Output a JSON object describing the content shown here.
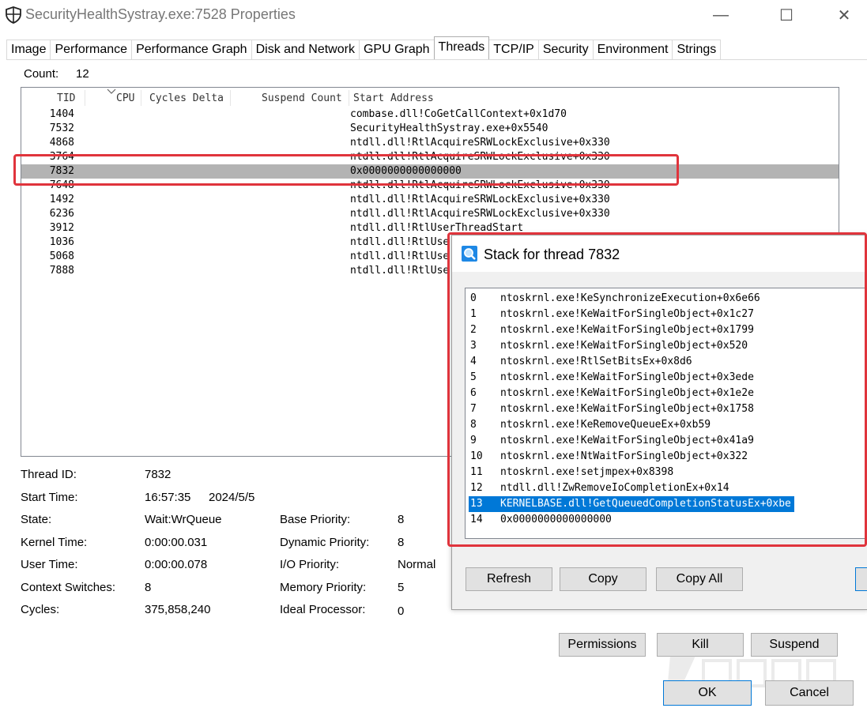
{
  "window": {
    "title": "SecurityHealthSystray.exe:7528 Properties",
    "minimize_glyph": "—",
    "maximize_glyph": "☐",
    "close_glyph": "✕"
  },
  "tabs": [
    {
      "label": "Image"
    },
    {
      "label": "Performance"
    },
    {
      "label": "Performance Graph"
    },
    {
      "label": "Disk and Network"
    },
    {
      "label": "GPU Graph"
    },
    {
      "label": "Threads",
      "active": true
    },
    {
      "label": "TCP/IP"
    },
    {
      "label": "Security"
    },
    {
      "label": "Environment"
    },
    {
      "label": "Strings"
    }
  ],
  "threads": {
    "count_label": "Count:",
    "count_value": "12",
    "columns": {
      "tid": "TID",
      "cpu": "CPU",
      "cycles": "Cycles Delta",
      "suspend": "Suspend Count",
      "start": "Start Address"
    },
    "rows": [
      {
        "tid": "1404",
        "addr": "combase.dll!CoGetCallContext+0x1d70"
      },
      {
        "tid": "7532",
        "addr": "SecurityHealthSystray.exe+0x5540"
      },
      {
        "tid": "4868",
        "addr": "ntdll.dll!RtlAcquireSRWLockExclusive+0x330"
      },
      {
        "tid": "3764",
        "addr": "ntdll.dll!RtlAcquireSRWLockExclusive+0x330"
      },
      {
        "tid": "7832",
        "addr": "0x0000000000000000",
        "selected": true
      },
      {
        "tid": "7648",
        "addr": "ntdll.dll!RtlAcquireSRWLockExclusive+0x330"
      },
      {
        "tid": "1492",
        "addr": "ntdll.dll!RtlAcquireSRWLockExclusive+0x330"
      },
      {
        "tid": "6236",
        "addr": "ntdll.dll!RtlAcquireSRWLockExclusive+0x330"
      },
      {
        "tid": "3912",
        "addr": "ntdll.dll!RtlUserThreadStart"
      },
      {
        "tid": "1036",
        "addr": "ntdll.dll!RtlUse"
      },
      {
        "tid": "5068",
        "addr": "ntdll.dll!RtlUse"
      },
      {
        "tid": "7888",
        "addr": "ntdll.dll!RtlUse"
      }
    ]
  },
  "details": {
    "thread_id_label": "Thread ID:",
    "thread_id": "7832",
    "start_time_label": "Start Time:",
    "start_time": "16:57:35",
    "start_date": "2024/5/5",
    "state_label": "State:",
    "state": "Wait:WrQueue",
    "kernel_time_label": "Kernel Time:",
    "kernel_time": "0:00:00.031",
    "user_time_label": "User Time:",
    "user_time": "0:00:00.078",
    "context_switches_label": "Context Switches:",
    "context_switches": "8",
    "cycles_label": "Cycles:",
    "cycles": "375,858,240",
    "base_priority_label": "Base Priority:",
    "base_priority": "8",
    "dynamic_priority_label": "Dynamic Priority:",
    "dynamic_priority": "8",
    "io_priority_label": "I/O Priority:",
    "io_priority": "Normal",
    "memory_priority_label": "Memory Priority:",
    "memory_priority": "5",
    "ideal_processor_label": "Ideal Processor:",
    "ideal_processor": "0"
  },
  "buttons": {
    "permissions": "Permissions",
    "kill": "Kill",
    "suspend": "Suspend",
    "ok": "OK",
    "cancel": "Cancel"
  },
  "stack_dialog": {
    "title": "Stack for thread 7832",
    "frames": [
      {
        "n": "0",
        "fn": "ntoskrnl.exe!KeSynchronizeExecution+0x6e66"
      },
      {
        "n": "1",
        "fn": "ntoskrnl.exe!KeWaitForSingleObject+0x1c27"
      },
      {
        "n": "2",
        "fn": "ntoskrnl.exe!KeWaitForSingleObject+0x1799"
      },
      {
        "n": "3",
        "fn": "ntoskrnl.exe!KeWaitForSingleObject+0x520"
      },
      {
        "n": "4",
        "fn": "ntoskrnl.exe!RtlSetBitsEx+0x8d6"
      },
      {
        "n": "5",
        "fn": "ntoskrnl.exe!KeWaitForSingleObject+0x3ede"
      },
      {
        "n": "6",
        "fn": "ntoskrnl.exe!KeWaitForSingleObject+0x1e2e"
      },
      {
        "n": "7",
        "fn": "ntoskrnl.exe!KeWaitForSingleObject+0x1758"
      },
      {
        "n": "8",
        "fn": "ntoskrnl.exe!KeRemoveQueueEx+0xb59"
      },
      {
        "n": "9",
        "fn": "ntoskrnl.exe!KeWaitForSingleObject+0x41a9"
      },
      {
        "n": "10",
        "fn": "ntoskrnl.exe!NtWaitForSingleObject+0x322"
      },
      {
        "n": "11",
        "fn": "ntoskrnl.exe!setjmpex+0x8398"
      },
      {
        "n": "12",
        "fn": "ntdll.dll!ZwRemoveIoCompletionEx+0x14"
      },
      {
        "n": "13",
        "fn": "KERNELBASE.dll!GetQueuedCompletionStatusEx+0xbe",
        "selected": true
      },
      {
        "n": "14",
        "fn": "0x0000000000000000"
      }
    ],
    "refresh": "Refresh",
    "copy": "Copy",
    "copy_all": "Copy All"
  },
  "colors": {
    "highlight_red": "#e0343c",
    "selection_blue": "#0078d7",
    "selection_gray": "#b3b3b3"
  }
}
